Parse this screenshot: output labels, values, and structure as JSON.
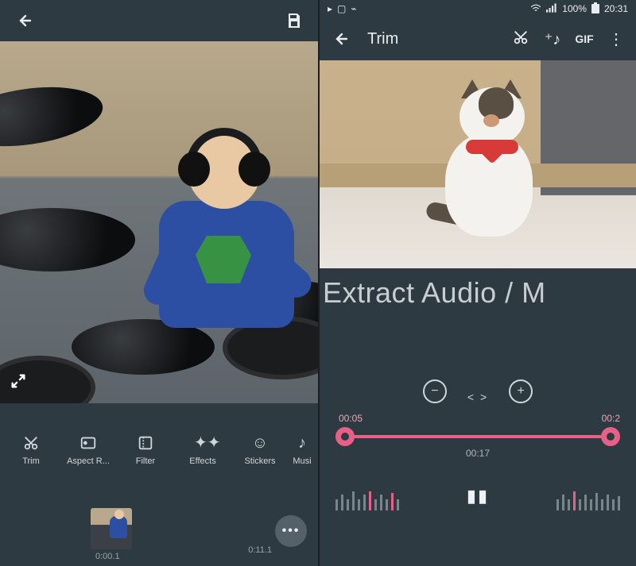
{
  "left": {
    "tools": {
      "trim": "Trim",
      "aspect": "Aspect R...",
      "filter": "Filter",
      "effects": "Effects",
      "stickers": "Stickers",
      "music": "Musi"
    },
    "strip": {
      "start": "0:00.1",
      "end": "0:11.1"
    }
  },
  "right": {
    "status": {
      "battery": "100%",
      "time": "20:31"
    },
    "header": {
      "title": "Trim",
      "gif": "GIF"
    },
    "caption": "Extract Audio / M",
    "slider": {
      "start": "00:05",
      "end": "00:2",
      "mid": "00:17"
    }
  }
}
